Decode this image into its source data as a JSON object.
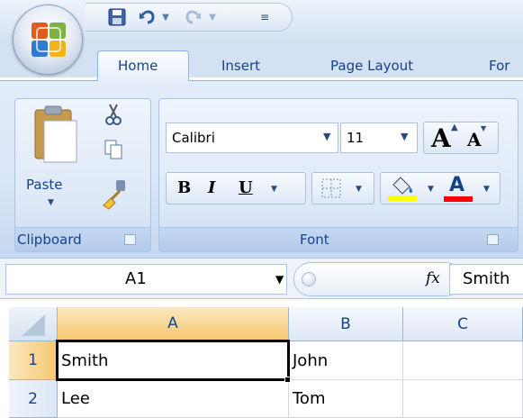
{
  "qat": {
    "icons": [
      "save-icon",
      "undo-icon",
      "redo-icon",
      "customize-qat-icon"
    ]
  },
  "tabs": [
    "Home",
    "Insert",
    "Page Layout",
    "For"
  ],
  "ribbon": {
    "clipboard": {
      "label": "Clipboard",
      "paste_label": "Paste",
      "icons": [
        "paste-icon",
        "cut-icon",
        "copy-icon",
        "format-painter-icon"
      ]
    },
    "font": {
      "label": "Font",
      "font_name": "Calibri",
      "font_size": "11",
      "grow_font": "A",
      "shrink_font": "A",
      "bold": "B",
      "italic": "I",
      "underline": "U",
      "font_color": "A",
      "fill_color_hex": "#ffff00",
      "font_color_hex": "#ff0000"
    }
  },
  "formula_bar": {
    "name_box": "A1",
    "fx": "fx",
    "value": "Smith"
  },
  "grid": {
    "columns": [
      "A",
      "B",
      "C"
    ],
    "rows": [
      {
        "num": "1",
        "cells": [
          "Smith",
          "John",
          ""
        ]
      },
      {
        "num": "2",
        "cells": [
          "Lee",
          "Tom",
          ""
        ]
      }
    ],
    "active_cell": "A1"
  },
  "colors": {
    "ribbon_blue": "#dbe7f7",
    "header_text": "#15428b",
    "active_col_header": "#f9d99f"
  }
}
